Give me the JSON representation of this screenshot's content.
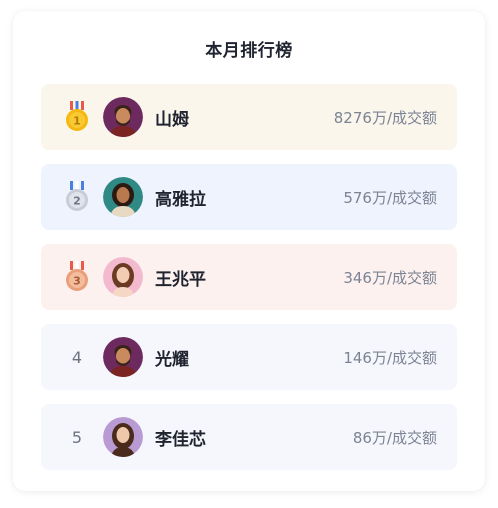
{
  "title": "本月排行榜",
  "rows": [
    {
      "rank": "1",
      "badge": "gold-medal",
      "name": "山姆",
      "amount": "8276万/成交额",
      "bg": "#faf6ec"
    },
    {
      "rank": "2",
      "badge": "silver-medal",
      "name": "高雅拉",
      "amount": "576万/成交额",
      "bg": "#eef3fd"
    },
    {
      "rank": "3",
      "badge": "bronze-medal",
      "name": "王兆平",
      "amount": "346万/成交额",
      "bg": "#fdf1ef"
    },
    {
      "rank": "4",
      "name": "光耀",
      "amount": "146万/成交额",
      "bg": "#f6f7fc"
    },
    {
      "rank": "5",
      "name": "李佳芯",
      "amount": "86万/成交额",
      "bg": "#f6f7fc"
    }
  ],
  "colors": {
    "gold": "#f5b80f",
    "silver": "#c7ccd8",
    "bronze": "#e9a07a",
    "ribbon_blue": "#4a7fe0",
    "ribbon_red": "#ea5a4a"
  }
}
